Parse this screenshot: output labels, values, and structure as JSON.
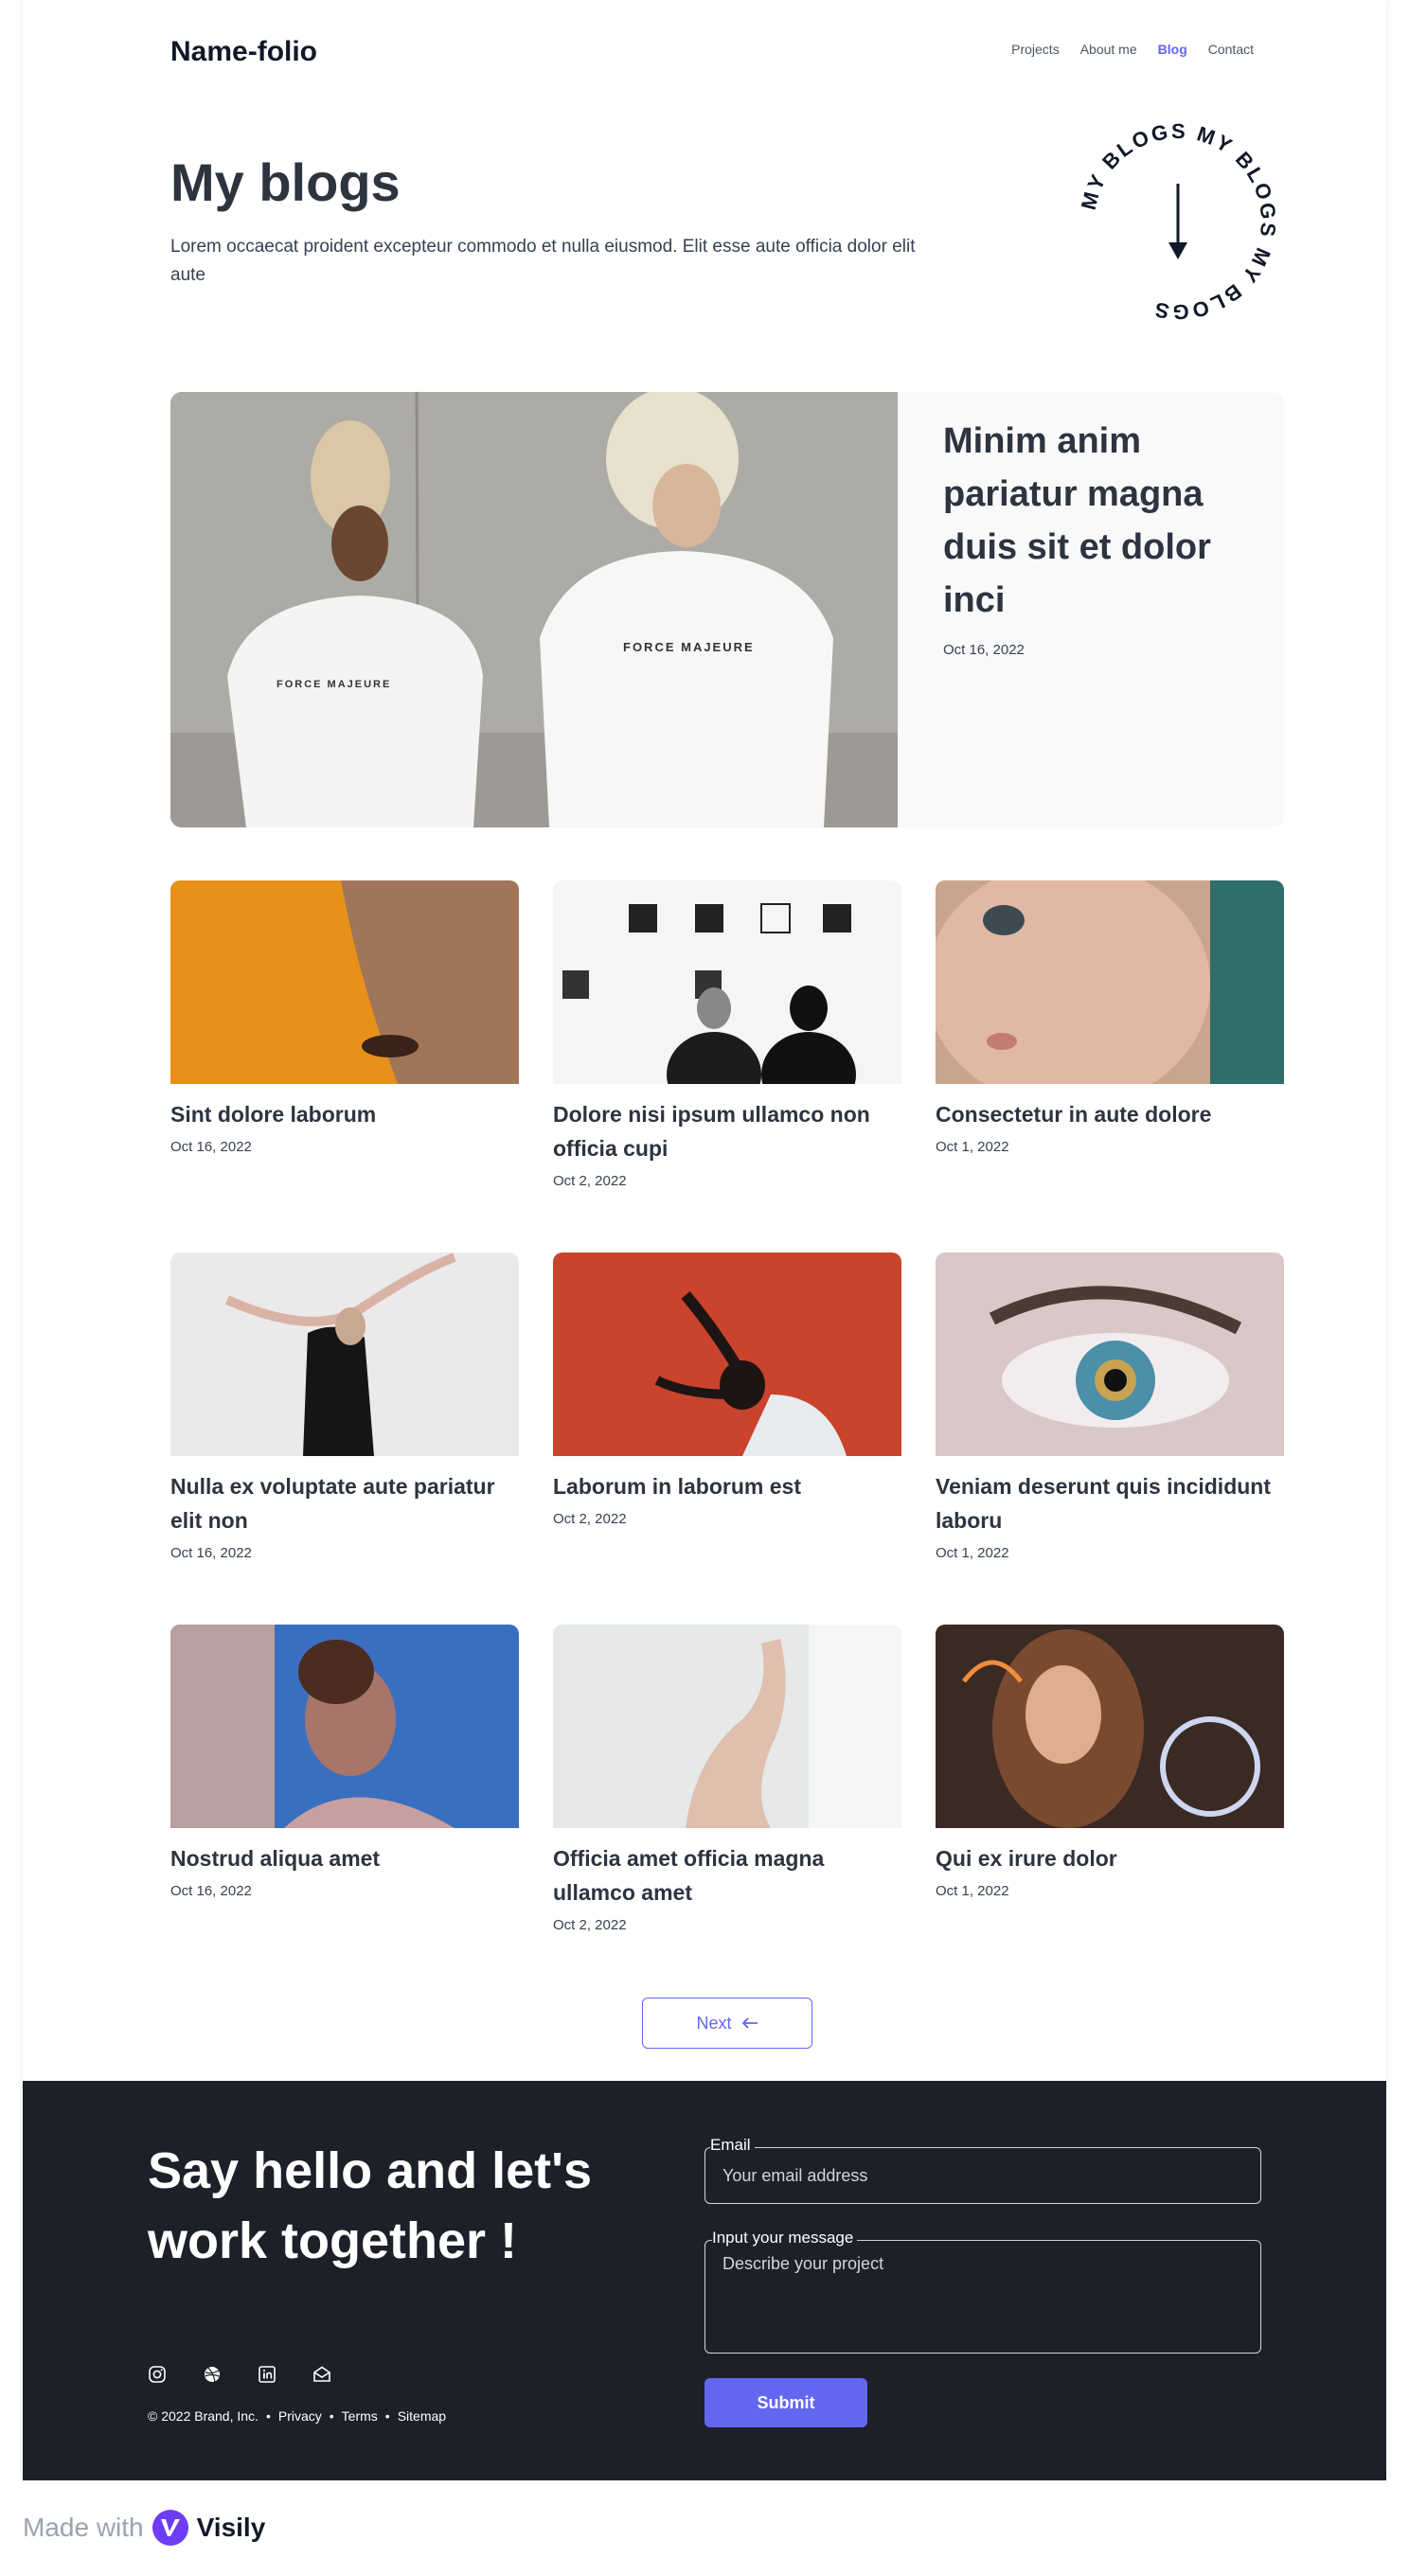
{
  "header": {
    "logo": "Name-folio",
    "nav": [
      "Projects",
      "About me",
      "Blog",
      "Contact"
    ],
    "active_nav": "Blog",
    "accent_color": "#6366f1"
  },
  "hero": {
    "title": "My blogs",
    "description": "Lorem occaecat proident excepteur commodo et nulla eiusmod. Elit esse aute officia dolor elit aute",
    "badge_text": "MY BLOGS MY BLOGS MY BLOGS"
  },
  "featured": {
    "title": "Minim anim pariatur magna duis sit et dolor inci",
    "date": "Oct 16, 2022",
    "shirt_text": "FORCE MAJEURE"
  },
  "posts": [
    {
      "title": "Sint dolore laborum",
      "date": "Oct 16, 2022"
    },
    {
      "title": "Dolore nisi ipsum ullamco non officia cupi",
      "date": "Oct 2, 2022"
    },
    {
      "title": "Consectetur in aute dolore",
      "date": "Oct 1, 2022"
    },
    {
      "title": "Nulla ex voluptate aute pariatur elit non",
      "date": "Oct 16, 2022"
    },
    {
      "title": "Laborum in laborum est",
      "date": "Oct 2, 2022"
    },
    {
      "title": "Veniam deserunt quis incididunt laboru",
      "date": "Oct 1, 2022"
    },
    {
      "title": "Nostrud aliqua amet",
      "date": "Oct 16, 2022"
    },
    {
      "title": "Officia amet officia magna ullamco amet",
      "date": "Oct 2, 2022"
    },
    {
      "title": "Qui ex irure dolor",
      "date": "Oct 1, 2022"
    }
  ],
  "pagination": {
    "next_label": "Next"
  },
  "footer": {
    "heading": "Say hello and let's work together !",
    "email_label": "Email",
    "email_placeholder": "Your email address",
    "message_label": "Input your message",
    "message_placeholder": "Describe your project",
    "submit_label": "Submit",
    "copyright": "© 2022 Brand, Inc.",
    "links": [
      "Privacy",
      "Terms",
      "Sitemap"
    ],
    "socials": [
      "instagram-icon",
      "dribbble-icon",
      "linkedin-icon",
      "mail-icon"
    ],
    "background_color": "#1d2029"
  },
  "made_with": {
    "prefix": "Made with",
    "brand": "Visily"
  }
}
